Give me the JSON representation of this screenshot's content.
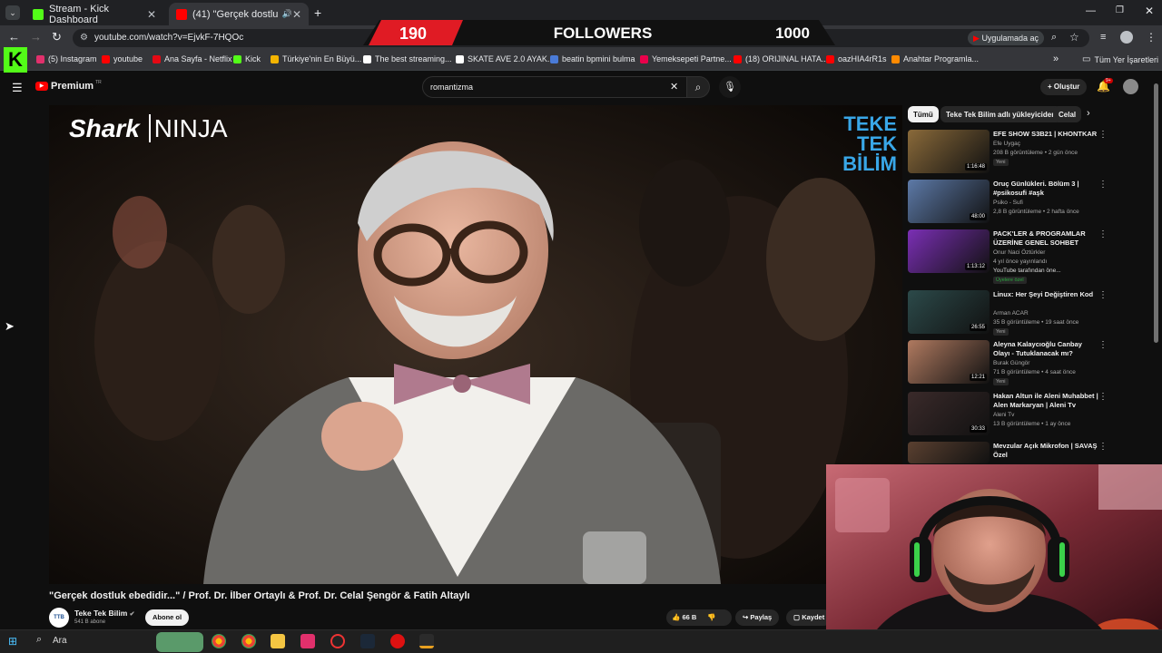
{
  "browser": {
    "tabs": [
      {
        "title": "Stream - Kick Dashboard",
        "active": false
      },
      {
        "title": "(41) \"Gerçek dostluk ebedi...",
        "active": true
      }
    ],
    "url": "youtube.com/watch?v=EjvkF-7HQOc",
    "install_app_label": "Uygulamada aç",
    "bookmarks": [
      {
        "label": "(5) Instagram",
        "color": "#e1306c"
      },
      {
        "label": "youtube",
        "color": "#ff0000"
      },
      {
        "label": "Ana Sayfa - Netflix",
        "color": "#e50914"
      },
      {
        "label": "Kick",
        "color": "#53fc18"
      },
      {
        "label": "Türkiye'nin En Büyü...",
        "color": "#f4b400"
      },
      {
        "label": "The best streaming...",
        "color": "#ffffff"
      },
      {
        "label": "SKATE AVE 2.0 AYAK...",
        "color": "#ffffff"
      },
      {
        "label": "beatin bpmini bulma",
        "color": "#4a7bd8"
      },
      {
        "label": "Yemeksepeti Partne...",
        "color": "#ea004b"
      },
      {
        "label": "(18) ORIJINAL HATA...",
        "color": "#ff0000"
      },
      {
        "label": "oazHIA4rR1s",
        "color": "#ff0000"
      },
      {
        "label": "Anahtar Programla...",
        "color": "#ff8a00"
      }
    ],
    "all_bookmarks_label": "Tüm Yer İşaretleri"
  },
  "overlay": {
    "current": "190",
    "label": "FOLLOWERS",
    "goal": "1000"
  },
  "youtube": {
    "logo_label": "Premium",
    "logo_region": "TR",
    "search_value": "romantizma",
    "create_label": "Oluştur",
    "notif_count": "9+",
    "video": {
      "brand_left": "Shark",
      "brand_left_2": "NINJA",
      "brand_right_1": "TEKE",
      "brand_right_2": "TEK",
      "brand_right_3": "BİLİM",
      "title": "\"Gerçek dostluk ebedidir...\" / Prof. Dr. İlber Ortaylı & Prof. Dr. Celal Şengör & Fatih Altaylı",
      "channel": "Teke Tek Bilim",
      "subscribers": "541 B abone",
      "subscribe_label": "Abone ol",
      "likes": "66 B",
      "share_label": "Paylaş",
      "save_label": "Kaydet"
    },
    "chips": [
      "Tümü",
      "Teke Tek Bilim adlı yükleyiciden",
      "Celal"
    ],
    "recommendations": [
      {
        "title": "EFE SHOW S3B21 | KHONTKAR",
        "channel": "Efe Uygaç",
        "meta": "208 B görüntüleme • 2 gün önce",
        "tag": "Yeni",
        "duration": "1:16:48",
        "color": "#8a6a3a"
      },
      {
        "title": "Oruç Günlükleri. Bölüm 3 | #psikosufi #aşk",
        "channel": "Psiko - Sufi",
        "meta": "2,8 B görüntüleme • 2 hafta önce",
        "tag": "",
        "duration": "48:00",
        "color": "#5d7aa8"
      },
      {
        "title": "PACK'LER & PROGRAMLAR ÜZERİNE GENEL SOHBET",
        "channel": "Onur Naci Öztürkler",
        "meta": "4 yıl önce yayınlandı",
        "tag": "Üyelere özel",
        "extra": "YouTube tarafından öne...",
        "duration": "1:13:12",
        "color": "#7b2fb5"
      },
      {
        "title": "Linux: Her Şeyi Değiştiren Kod",
        "channel": "Arman ACAR",
        "meta": "35 B görüntüleme • 19 saat önce",
        "tag": "Yeni",
        "duration": "26:55",
        "color": "#2c4a4a"
      },
      {
        "title": "Aleyna Kalaycıoğlu Canbay Olayı - Tutuklanacak mı?",
        "channel": "Burak Güngör",
        "meta": "71 B görüntüleme • 4 saat önce",
        "tag": "Yeni",
        "duration": "12:21",
        "color": "#b07a60"
      },
      {
        "title": "Hakan Altun ile Aleni Muhabbet | Alen Markaryan | Aleni Tv",
        "channel": "Aleni Tv",
        "meta": "13 B görüntüleme • 1 ay önce",
        "tag": "",
        "duration": "30:33",
        "color": "#3a2a2a"
      },
      {
        "title": "Mevzular Açık Mikrofon | SAVAŞ Özel",
        "channel": "",
        "meta": "",
        "tag": "",
        "duration": "",
        "color": "#5a4030"
      }
    ]
  },
  "taskbar": {
    "search_label": "Ara"
  }
}
